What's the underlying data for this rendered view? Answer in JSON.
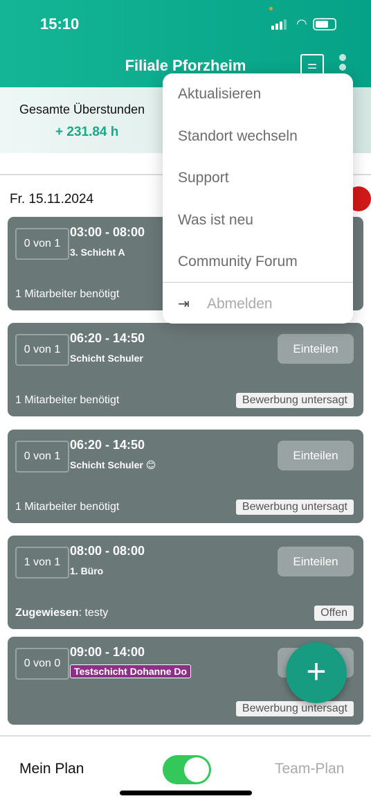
{
  "status_bar": {
    "time": "15:10"
  },
  "header": {
    "title": "Filiale Pforzheim",
    "filter_icon": "sliders-icon",
    "menu_icon": "more-vertical-icon"
  },
  "summary": {
    "label": "Gesamte Überstunden",
    "value": "+ 231.84 h"
  },
  "date": "Fr. 15.11.2024",
  "colors": {
    "brand": "#0fb596",
    "card": "#6b7878",
    "tag": "#8d2f86",
    "toggle": "#34c759"
  },
  "shifts": [
    {
      "count": "0 von 1",
      "time": "03:00 - 08:00",
      "name": "3. Schicht A",
      "footer": "1 Mitarbeiter benötigt"
    },
    {
      "count": "0 von 1",
      "time": "06:20 - 14:50",
      "name": "Schicht Schuler",
      "button": "Einteilen",
      "footer": "1 Mitarbeiter benötigt",
      "status": "Bewerbung untersagt"
    },
    {
      "count": "0 von 1",
      "time": "06:20 - 14:50",
      "name": "Schicht Schuler 😊",
      "button": "Einteilen",
      "footer": "1 Mitarbeiter benötigt",
      "status": "Bewerbung untersagt"
    },
    {
      "count": "1 von 1",
      "time": "08:00 - 08:00",
      "name": "1. Büro",
      "button": "Einteilen",
      "footer_label": "Zugewiesen",
      "footer_value": ": testy",
      "status": "Offen"
    },
    {
      "count": "0 von 0",
      "time": "09:00 - 14:00",
      "name": "Testschicht Dohanne Do",
      "button": "Einteilen",
      "status": "Bewerbung untersagt"
    }
  ],
  "menu": {
    "items": [
      "Aktualisieren",
      "Standort wechseln",
      "Support",
      "Was ist neu",
      "Community Forum"
    ],
    "logout": "Abmelden"
  },
  "footer": {
    "left": "Mein Plan",
    "right": "Team-Plan",
    "toggle_on": true
  }
}
